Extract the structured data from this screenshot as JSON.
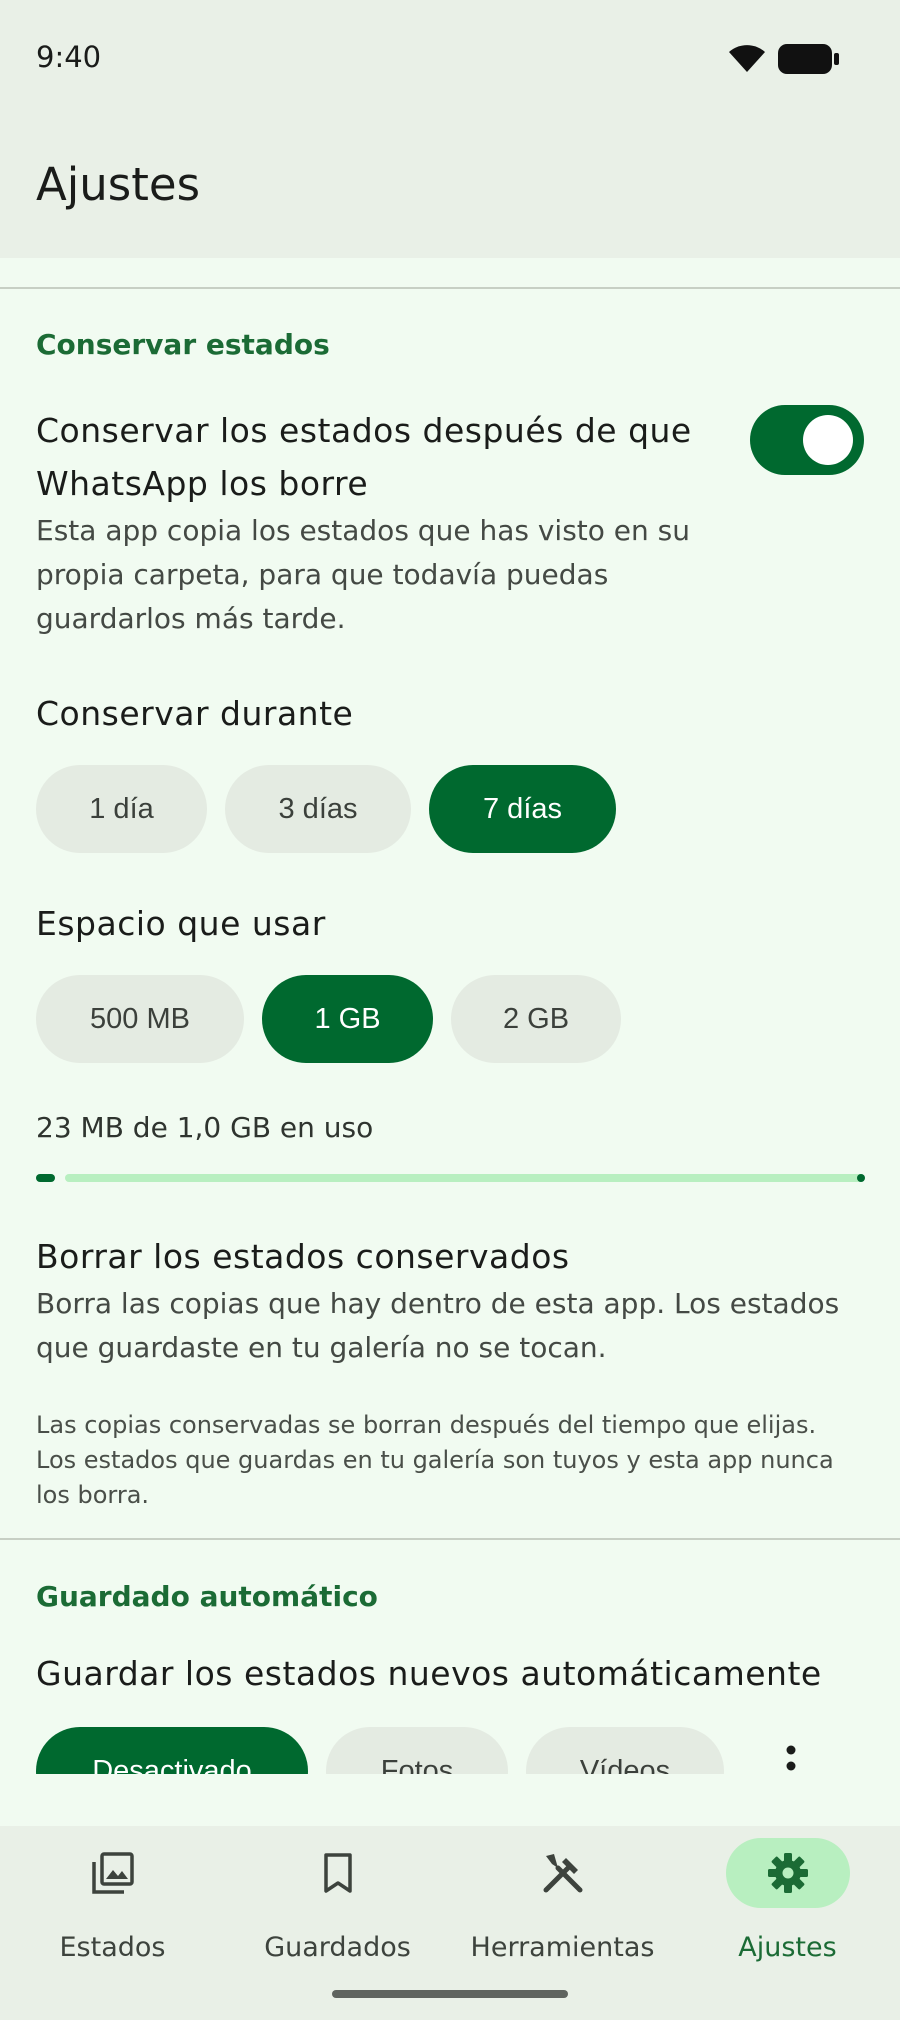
{
  "status_bar": {
    "time": "9:40"
  },
  "app_bar": {
    "title": "Ajustes"
  },
  "sections": {
    "keep": {
      "header": "Conservar estados",
      "toggle_title_line1": "Conservar los estados después de que",
      "toggle_title_line2": "WhatsApp los borre",
      "toggle_desc_line1": "Esta app copia los estados que has visto en su",
      "toggle_desc_line2": "propia carpeta, para que todavía puedas",
      "toggle_desc_line3": "guardarlos más tarde.",
      "toggle_on": true,
      "duration_label": "Conservar durante",
      "duration_options": [
        "1 día",
        "3 días",
        "7 días"
      ],
      "duration_selected": "7 días",
      "space_label": "Espacio que usar",
      "space_options": [
        "500 MB",
        "1 GB",
        "2 GB"
      ],
      "space_selected": "1 GB",
      "usage_text": "23 MB de 1,0 GB en uso",
      "usage_fraction": 0.023,
      "delete_title": "Borrar los estados conservados",
      "delete_desc_line1": "Borra las copias que hay dentro de esta app. Los estados",
      "delete_desc_line2": "que guardaste en tu galería no se tocan.",
      "note_line1": "Las copias conservadas se borran después del tiempo que elijas.",
      "note_line2": "Los estados que guardas en tu galería son tuyos y esta app nunca",
      "note_line3": "los borra."
    },
    "auto": {
      "header": "Guardado automático",
      "title": "Guardar los estados nuevos automáticamente",
      "options": [
        "Desactivado",
        "Fotos",
        "Vídeos"
      ],
      "selected": "Desactivado"
    }
  },
  "bottom_nav": [
    {
      "label": "Estados",
      "icon": "photo-library-icon",
      "active": false
    },
    {
      "label": "Guardados",
      "icon": "bookmark-icon",
      "active": false
    },
    {
      "label": "Herramientas",
      "icon": "tools-icon",
      "active": false
    },
    {
      "label": "Ajustes",
      "icon": "gear-icon",
      "active": true
    }
  ],
  "colors": {
    "accent": "#00692f",
    "accent_container": "#b8efc0",
    "section_header": "#1b6b35",
    "background": "#f1fbf1",
    "bar_background": "#e9f0e7"
  }
}
